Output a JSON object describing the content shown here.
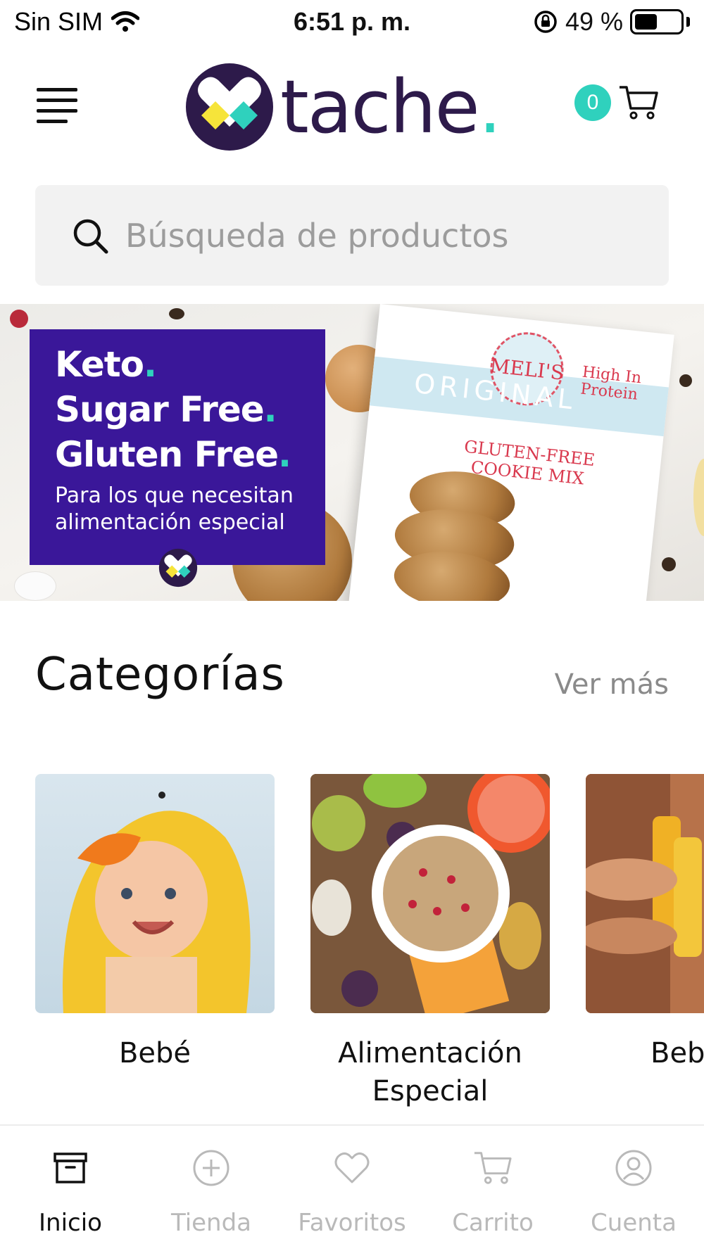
{
  "status_bar": {
    "carrier": "Sin SIM",
    "time": "6:51 p. m.",
    "battery_percent": "49 %",
    "battery_level": 0.49
  },
  "header": {
    "logo_text": "tache",
    "logo_dot": ".",
    "cart_count": "0",
    "colors": {
      "brand_purple": "#2d1a4a",
      "accent_teal": "#2fd1bd",
      "accent_yellow": "#f6e43a"
    }
  },
  "search": {
    "placeholder": "Búsqueda de productos"
  },
  "banner": {
    "line1": "Keto",
    "line2": "Sugar Free",
    "line3": "Gluten Free",
    "dot": ".",
    "subtitle_line1": "Para los que necesitan",
    "subtitle_line2": "alimentación especial",
    "box_brand": "MELI'S",
    "box_title": "ORIGINAL",
    "box_badge_line1": "High In",
    "box_badge_line2": "Protein",
    "box_gf_line1": "GLUTEN-FREE",
    "box_gf_line2": "COOKIE MIX",
    "panel_color": "#3a1799"
  },
  "categories": {
    "title": "Categorías",
    "see_more": "Ver más",
    "items": [
      {
        "label_line1": "Bebé",
        "label_line2": ""
      },
      {
        "label_line1": "Alimentación",
        "label_line2": "Especial"
      },
      {
        "label_line1": "Beb",
        "label_line2": ""
      }
    ]
  },
  "bottom_nav": {
    "items": [
      {
        "label": "Inicio",
        "icon": "archive-box-icon",
        "active": true
      },
      {
        "label": "Tienda",
        "icon": "plus-circle-icon",
        "active": false
      },
      {
        "label": "Favoritos",
        "icon": "heart-icon",
        "active": false
      },
      {
        "label": "Carrito",
        "icon": "cart-icon",
        "active": false
      },
      {
        "label": "Cuenta",
        "icon": "user-circle-icon",
        "active": false
      }
    ]
  }
}
